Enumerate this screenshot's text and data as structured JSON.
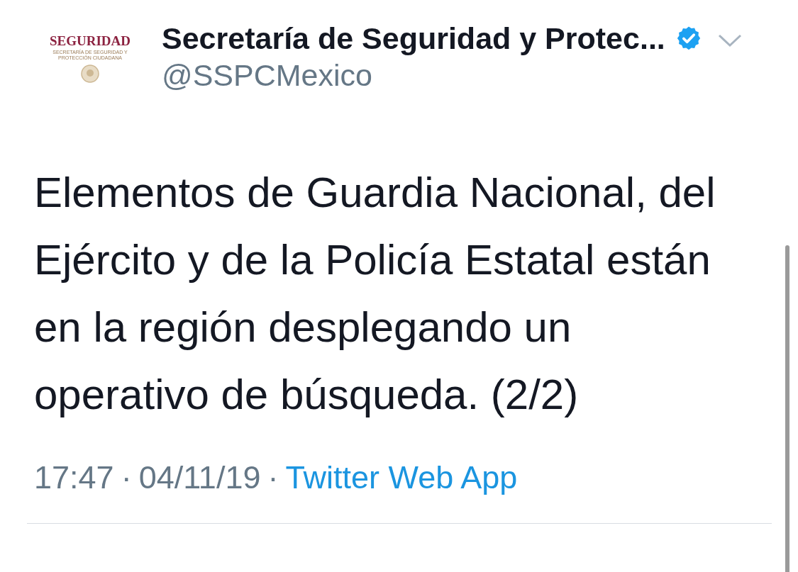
{
  "account": {
    "logo_title": "SEGURIDAD",
    "logo_subtitle": "SECRETARÍA DE SEGURIDAD Y PROTECCIÓN CIUDADANA",
    "name": "Secretaría de Seguridad y Protec...",
    "verified": true,
    "handle": "@SSPCMexico"
  },
  "tweet": {
    "text": "Elementos de Guardia Nacional, del Ejército y de la Policía Estatal están en la región desplegando un operativo de búsqueda. (2/2)"
  },
  "meta": {
    "time": "17:47",
    "separator_1": "·",
    "date": "04/11/19",
    "separator_2": "·",
    "source": "Twitter Web App"
  }
}
